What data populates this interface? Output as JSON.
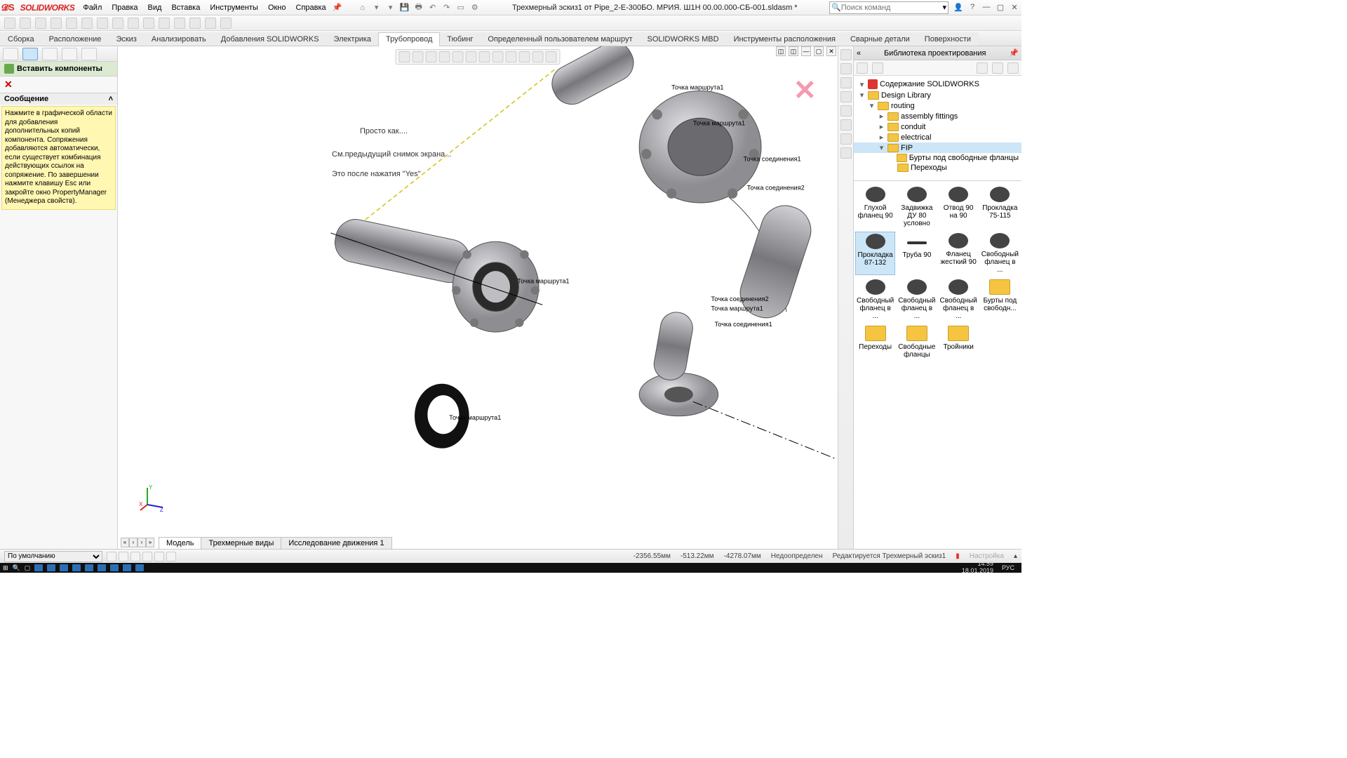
{
  "app": {
    "logo": "SOLIDWORKS"
  },
  "menu": [
    "Файл",
    "Правка",
    "Вид",
    "Вставка",
    "Инструменты",
    "Окно",
    "Справка"
  ],
  "document_title": "Трехмерный эскиз1 от Pipe_2-E-300БО. МРИЯ. Ш1Н 00.00.000-СБ-001.sldasm *",
  "search_placeholder": "Поиск команд",
  "cmd_tabs": [
    "Сборка",
    "Расположение",
    "Эскиз",
    "Анализировать",
    "Добавления SOLIDWORKS",
    "Электрика",
    "Трубопровод",
    "Тюбинг",
    "Определенный пользователем маршрут",
    "SOLIDWORKS MBD",
    "Инструменты расположения",
    "Сварные детали",
    "Поверхности"
  ],
  "cmd_tab_active": 6,
  "pm": {
    "title": "Вставить компоненты",
    "section": "Сообщение",
    "message": "Нажмите в графической области для добавления дополнительных копий компонента. Сопряжения добавляются автоматически, если существует комбинация действующих ссылок на сопряжение. По завершении нажмите клавишу Esc или закройте окно PropertyManager (Менеджера свойств)."
  },
  "gfx_notes": {
    "n1": "Просто как....",
    "n2": "См.предыдущий снимок экрана...",
    "n3": "Это после нажатия \"Yes\""
  },
  "annotations": {
    "p1": "Точка маршрута1",
    "p2": "Точка маршрута1",
    "p3": "Точка соединения1",
    "p4": "Точка соединения2",
    "p5": "Точка маршрута1",
    "p6": "Точка соединения2",
    "p7": "Точка маршрута1",
    "p8": "Точка соединения1",
    "p9": "Точка маршрута1"
  },
  "bottom_tabs": [
    "Модель",
    "Трехмерные виды",
    "Исследование движения 1"
  ],
  "status": {
    "display_state": "По умолчанию",
    "coord1": "-2356.55мм",
    "coord2": "-513.22мм",
    "coord3": "-4278.07мм",
    "defined": "Недоопределен",
    "edit": "Редактируется Трехмерный эскиз1",
    "custom": "Настройка"
  },
  "library": {
    "title": "Библиотека проектирования",
    "tree": [
      {
        "label": "Содержание SOLIDWORKS",
        "icon": "sw",
        "indent": 0,
        "exp": "▾"
      },
      {
        "label": "Design Library",
        "icon": "fold",
        "indent": 0,
        "exp": "▾"
      },
      {
        "label": "routing",
        "icon": "fold",
        "indent": 1,
        "exp": "▾"
      },
      {
        "label": "assembly fittings",
        "icon": "fold",
        "indent": 2,
        "exp": "▸"
      },
      {
        "label": "conduit",
        "icon": "fold",
        "indent": 2,
        "exp": "▸"
      },
      {
        "label": "electrical",
        "icon": "fold",
        "indent": 2,
        "exp": "▸"
      },
      {
        "label": "FIP",
        "icon": "fold",
        "indent": 2,
        "exp": "▾",
        "sel": true
      },
      {
        "label": "Бурты под свободные фланцы",
        "icon": "fold",
        "indent": 3,
        "exp": ""
      },
      {
        "label": "Переходы",
        "icon": "fold",
        "indent": 3,
        "exp": ""
      }
    ],
    "items": [
      {
        "label": "Глухой фланец 90",
        "t": "d"
      },
      {
        "label": "Задвижка ДУ 80 условно",
        "t": "d"
      },
      {
        "label": "Отвод 90 на 90",
        "t": "d"
      },
      {
        "label": "Прокладка 75-115",
        "t": "d"
      },
      {
        "label": "Прокладка 87-132",
        "t": "d",
        "sel": true
      },
      {
        "label": "Труба 90",
        "t": "pipe"
      },
      {
        "label": "Фланец жесткий 90",
        "t": "d"
      },
      {
        "label": "Свободный фланец в ...",
        "t": "d"
      },
      {
        "label": "Свободный фланец в ...",
        "t": "d"
      },
      {
        "label": "Свободный фланец в ...",
        "t": "d"
      },
      {
        "label": "Свободный фланец в ...",
        "t": "d"
      },
      {
        "label": "Бурты под свободн...",
        "t": "fold"
      },
      {
        "label": "Переходы",
        "t": "fold"
      },
      {
        "label": "Свободные фланцы",
        "t": "fold"
      },
      {
        "label": "Тройники",
        "t": "fold"
      }
    ]
  },
  "taskbar": {
    "time": "14:59",
    "date": "18.01.2019",
    "lang": "РУС"
  }
}
